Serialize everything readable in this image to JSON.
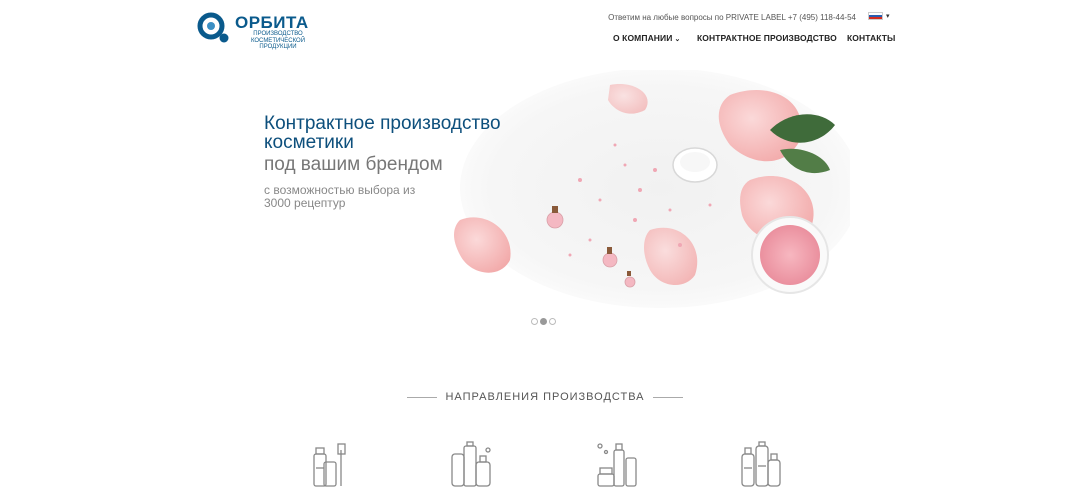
{
  "header": {
    "logo": {
      "name": "ОРБИТА",
      "subtitle_line1": "ПРОИЗВОДСТВО КОСМЕТИЧЕСКОЙ",
      "subtitle_line2": "ПРОДУКЦИИ",
      "brand_color": "#0a5a8c"
    },
    "contact_text": "Ответим на любые вопросы по PRIVATE LABEL +7 (495) 118-44-54",
    "language": {
      "icon": "flag-ru-icon",
      "caret": "▾"
    },
    "nav": [
      {
        "label": "О КОМПАНИИ",
        "has_dropdown": true,
        "chevron": "⌄"
      },
      {
        "label": "КОНТРАКТНОЕ ПРОИЗВОДСТВО",
        "has_dropdown": false
      },
      {
        "label": "КОНТАКТЫ",
        "has_dropdown": false
      }
    ]
  },
  "hero": {
    "title": "Контрактное производство косметики",
    "subtitle": "под вашим брендом",
    "description": "с возможностью выбора из 3000 рецептур",
    "title_color": "#0d4f7c",
    "slides": {
      "count": 3,
      "active_index": 1
    }
  },
  "section": {
    "title": "НАПРАВЛЕНИЯ ПРОИЗВОДСТВА"
  },
  "directions": [
    {
      "icon": "toothpaste-brush-icon"
    },
    {
      "icon": "cosmetic-bottles-icon"
    },
    {
      "icon": "cream-jars-icon"
    },
    {
      "icon": "shampoo-bottles-icon"
    }
  ]
}
